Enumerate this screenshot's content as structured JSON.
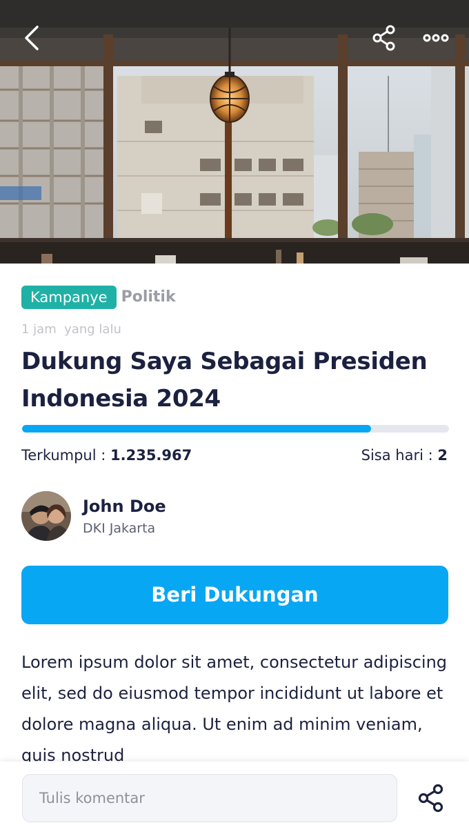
{
  "header": {
    "back_icon": "chevron-left-icon",
    "share_icon": "share-icon",
    "more_icon": "more-horizontal-icon"
  },
  "campaign": {
    "badge": "Kampanye",
    "category": "Politik",
    "time_ago": "1 jam  yang lalu",
    "title": "Dukung Saya Sebagai Presiden Indonesia 2024",
    "progress_fraction": 0.818,
    "collected_label": "Terkumpul : ",
    "collected_value": "1.235.967",
    "days_left_label": "Sisa hari : ",
    "days_left_value": "2"
  },
  "author": {
    "name": "John Doe",
    "location": "DKI Jakarta"
  },
  "cta": {
    "label": "Beri Dukungan"
  },
  "description": "Lorem ipsum dolor sit amet, consectetur adipiscing elit, sed do eiusmod tempor incididunt ut labore et dolore magna aliqua. Ut enim ad minim veniam, quis nostrud",
  "comment": {
    "placeholder": "Tulis komentar",
    "share_icon": "share-icon"
  },
  "colors": {
    "accent": "#08a7f4",
    "badge": "#1fb1a6",
    "text_dark": "#1c2140",
    "muted": "#9a9ca6"
  }
}
